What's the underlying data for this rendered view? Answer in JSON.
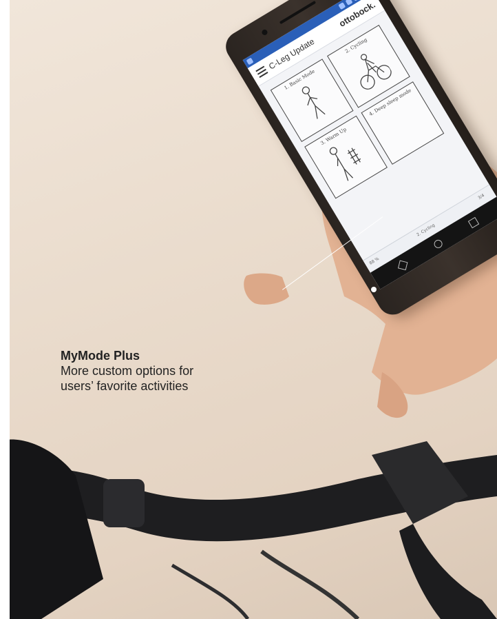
{
  "caption": {
    "title": "MyMode Plus",
    "body_line1": "More custom options for",
    "body_line2": "users’ favorite activities"
  },
  "phone": {
    "brand": "ottobock.",
    "app_title": "C-Leg Update",
    "tiles": [
      {
        "label": "1. Basic Mode",
        "icon": "walking-person-icon"
      },
      {
        "label": "2. Cycling",
        "icon": "cyclist-icon"
      },
      {
        "label": "3. Warm Up",
        "icon": "warm-up-icon"
      },
      {
        "label": "4. Deep sleep mode",
        "icon": "blank-icon"
      }
    ],
    "bottom_left": "88 %",
    "bottom_center": "2. Cycling",
    "bottom_right": "3/4"
  },
  "colors": {
    "background_wall": "#ebdccd",
    "statusbar": "#2a5fb8",
    "phone_body": "#2f2823",
    "caption_text": "#222222",
    "callout": "#ffffff"
  }
}
